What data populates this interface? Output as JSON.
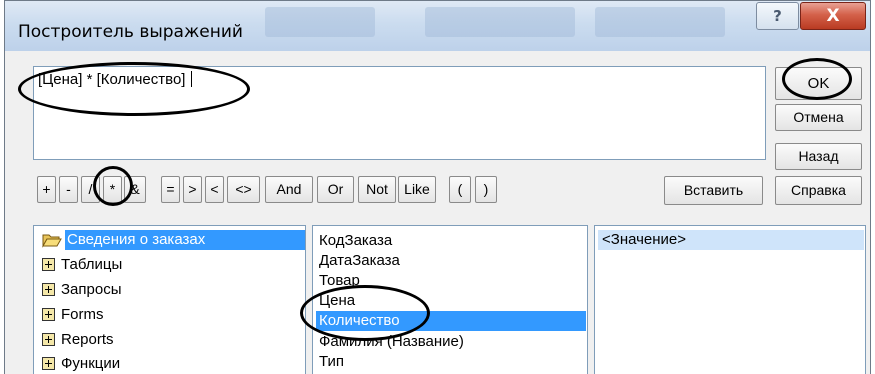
{
  "window": {
    "title": "Построитель выражений",
    "help_glyph": "?",
    "close_glyph": "X"
  },
  "expression": {
    "value": "[Цена] * [Количество]"
  },
  "buttons": {
    "ok": "OK",
    "cancel": "Отмена",
    "back": "Назад",
    "insert": "Вставить",
    "help": "Справка"
  },
  "operators": [
    "+",
    "-",
    "/",
    "*",
    "&",
    "=",
    ">",
    "<",
    "<>",
    "And",
    "Or",
    "Not",
    "Like",
    "(",
    ")"
  ],
  "tree": {
    "items": [
      {
        "label": "Сведения о заказах",
        "icon": "folder-open-icon",
        "selected": true
      },
      {
        "label": "Таблицы",
        "icon": "plus-box-icon"
      },
      {
        "label": "Запросы",
        "icon": "plus-box-icon"
      },
      {
        "label": "Forms",
        "icon": "plus-box-icon"
      },
      {
        "label": "Reports",
        "icon": "plus-box-icon"
      },
      {
        "label": "Функции",
        "icon": "plus-box-icon"
      }
    ]
  },
  "fields": {
    "items": [
      "КодЗаказа",
      "ДатаЗаказа",
      "Товар",
      "Цена",
      "Количество",
      "Фамилия (Название)",
      "Тип"
    ],
    "selected_index": 4
  },
  "values": {
    "items": [
      "<Значение>"
    ]
  },
  "colors": {
    "selection": "#3399ff",
    "close_button": "#c9452c",
    "title_bar": "#cbdcef"
  }
}
